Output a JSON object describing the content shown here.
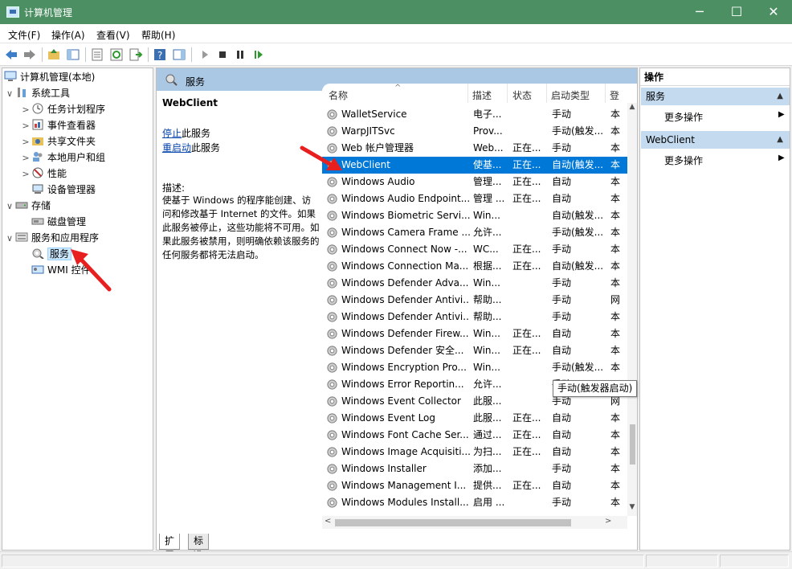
{
  "window": {
    "title": "计算机管理",
    "controls": {
      "minimize": "─",
      "maximize": "☐",
      "close": "✕"
    }
  },
  "menu": [
    "文件(F)",
    "操作(A)",
    "查看(V)",
    "帮助(H)"
  ],
  "tree": [
    {
      "label": "计算机管理(本地)",
      "level": 0,
      "expander": ""
    },
    {
      "label": "系统工具",
      "level": 1,
      "expander": "∨"
    },
    {
      "label": "任务计划程序",
      "level": 2,
      "expander": ">"
    },
    {
      "label": "事件查看器",
      "level": 2,
      "expander": ">"
    },
    {
      "label": "共享文件夹",
      "level": 2,
      "expander": ">"
    },
    {
      "label": "本地用户和组",
      "level": 2,
      "expander": ">"
    },
    {
      "label": "性能",
      "level": 2,
      "expander": ">"
    },
    {
      "label": "设备管理器",
      "level": 2,
      "expander": ""
    },
    {
      "label": "存储",
      "level": 1,
      "expander": "∨"
    },
    {
      "label": "磁盘管理",
      "level": 2,
      "expander": ""
    },
    {
      "label": "服务和应用程序",
      "level": 1,
      "expander": "∨"
    },
    {
      "label": "服务",
      "level": 2,
      "expander": "",
      "selected": true
    },
    {
      "label": "WMI 控件",
      "level": 2,
      "expander": ""
    }
  ],
  "center": {
    "header": "服务",
    "selected_service": "WebClient",
    "action_stop_link": "停止",
    "action_stop_rest": "此服务",
    "action_restart_link": "重启动",
    "action_restart_rest": "此服务",
    "desc_label": "描述:",
    "desc_text": "使基于 Windows 的程序能创建、访问和修改基于 Internet 的文件。如果此服务被停止，这些功能将不可用。如果此服务被禁用，则明确依赖该服务的任何服务都将无法启动。"
  },
  "columns": {
    "name": "名称",
    "desc": "描述",
    "status": "状态",
    "start": "启动类型",
    "logon": "登"
  },
  "services": [
    {
      "name": "WalletService",
      "desc": "电子...",
      "status": "",
      "start": "手动",
      "logon": "本"
    },
    {
      "name": "WarpJITSvc",
      "desc": "Prov...",
      "status": "",
      "start": "手动(触发...",
      "logon": "本"
    },
    {
      "name": "Web 帐户管理器",
      "desc": "Web...",
      "status": "正在...",
      "start": "手动",
      "logon": "本"
    },
    {
      "name": "WebClient",
      "desc": "使基...",
      "status": "正在...",
      "start": "自动(触发...",
      "logon": "本",
      "selected": true
    },
    {
      "name": "Windows Audio",
      "desc": "管理...",
      "status": "正在...",
      "start": "自动",
      "logon": "本"
    },
    {
      "name": "Windows Audio Endpoint...",
      "desc": "管理 ...",
      "status": "正在...",
      "start": "自动",
      "logon": "本"
    },
    {
      "name": "Windows Biometric Servi...",
      "desc": "Win...",
      "status": "",
      "start": "自动(触发...",
      "logon": "本"
    },
    {
      "name": "Windows Camera Frame ...",
      "desc": "允许...",
      "status": "",
      "start": "手动(触发...",
      "logon": "本"
    },
    {
      "name": "Windows Connect Now -...",
      "desc": "WC...",
      "status": "正在...",
      "start": "手动",
      "logon": "本"
    },
    {
      "name": "Windows Connection Ma...",
      "desc": "根据...",
      "status": "正在...",
      "start": "自动(触发...",
      "logon": "本"
    },
    {
      "name": "Windows Defender Adva...",
      "desc": "Win...",
      "status": "",
      "start": "手动",
      "logon": "本"
    },
    {
      "name": "Windows Defender Antivi...",
      "desc": "帮助...",
      "status": "",
      "start": "手动",
      "logon": "网"
    },
    {
      "name": "Windows Defender Antivi...",
      "desc": "帮助...",
      "status": "",
      "start": "手动",
      "logon": "本"
    },
    {
      "name": "Windows Defender Firew...",
      "desc": "Win...",
      "status": "正在...",
      "start": "自动",
      "logon": "本"
    },
    {
      "name": "Windows Defender 安全...",
      "desc": "Win...",
      "status": "正在...",
      "start": "自动",
      "logon": "本"
    },
    {
      "name": "Windows Encryption Pro...",
      "desc": "Win...",
      "status": "",
      "start": "手动(触发...",
      "logon": "本"
    },
    {
      "name": "Windows Error Reportin...",
      "desc": "允许...",
      "status": "",
      "start": "手动",
      "logon": ""
    },
    {
      "name": "Windows Event Collector",
      "desc": "此服...",
      "status": "",
      "start": "手动",
      "logon": "网"
    },
    {
      "name": "Windows Event Log",
      "desc": "此服...",
      "status": "正在...",
      "start": "自动",
      "logon": "本"
    },
    {
      "name": "Windows Font Cache Ser...",
      "desc": "通过...",
      "status": "正在...",
      "start": "自动",
      "logon": "本"
    },
    {
      "name": "Windows Image Acquisiti...",
      "desc": "为扫...",
      "status": "正在...",
      "start": "自动",
      "logon": "本"
    },
    {
      "name": "Windows Installer",
      "desc": "添加...",
      "status": "",
      "start": "手动",
      "logon": "本"
    },
    {
      "name": "Windows Management I...",
      "desc": "提供...",
      "status": "正在...",
      "start": "自动",
      "logon": "本"
    },
    {
      "name": "Windows Modules Install...",
      "desc": "启用 ...",
      "status": "",
      "start": "手动",
      "logon": "本"
    }
  ],
  "tooltip": "手动(触发器启动)",
  "tabs": [
    "扩展",
    "标准"
  ],
  "actions": {
    "title": "操作",
    "sections": [
      {
        "label": "服务",
        "item": "更多操作"
      },
      {
        "label": "WebClient",
        "item": "更多操作"
      }
    ]
  },
  "colors": {
    "titlebar": "#4b8f62",
    "selection": "#0078d7",
    "header": "#aac7e4",
    "section": "#c4daef",
    "arrow": "#e81f1f"
  }
}
